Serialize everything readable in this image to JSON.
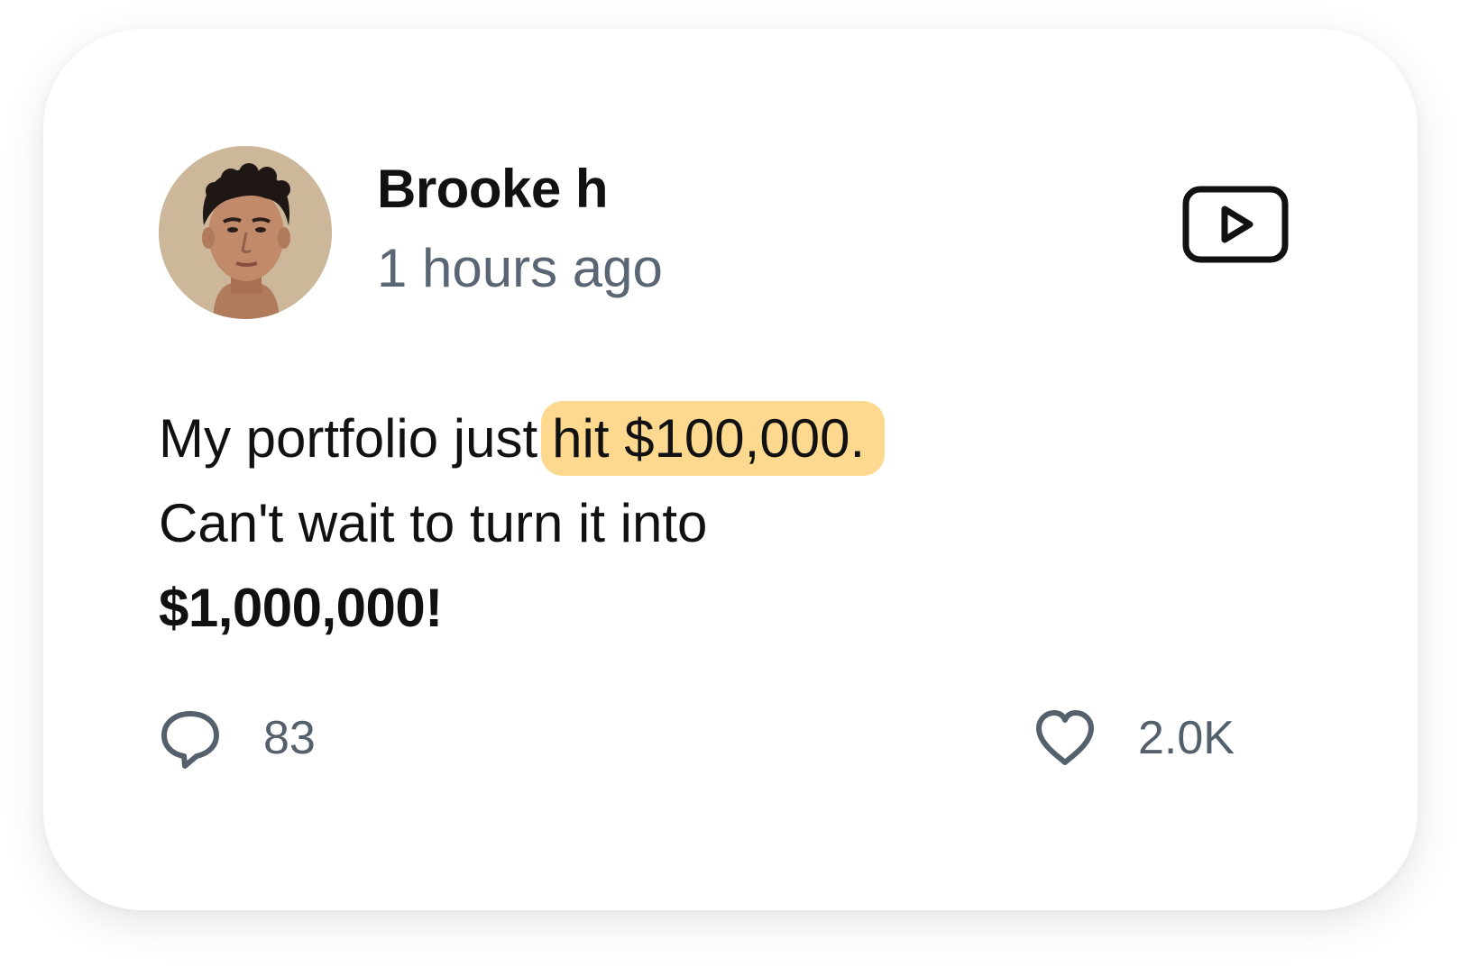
{
  "post": {
    "author_name": "Brooke h",
    "timestamp": "1 hours ago",
    "avatar_icon": "person-portrait",
    "video_icon": "play-video-icon",
    "body": {
      "line1_prefix": "My portfolio just",
      "line1_highlight": "hit $100,000.",
      "line2": "Can't wait to turn it into",
      "line3_bold": "$1,000,000!"
    },
    "highlight_color": "#fcd98f",
    "actions": {
      "comments": {
        "icon": "comment-icon",
        "count": "83"
      },
      "likes": {
        "icon": "heart-icon",
        "count": "2.0K"
      }
    }
  },
  "colors": {
    "text_primary": "#111111",
    "text_secondary": "#5a6673",
    "card_background": "#ffffff"
  }
}
